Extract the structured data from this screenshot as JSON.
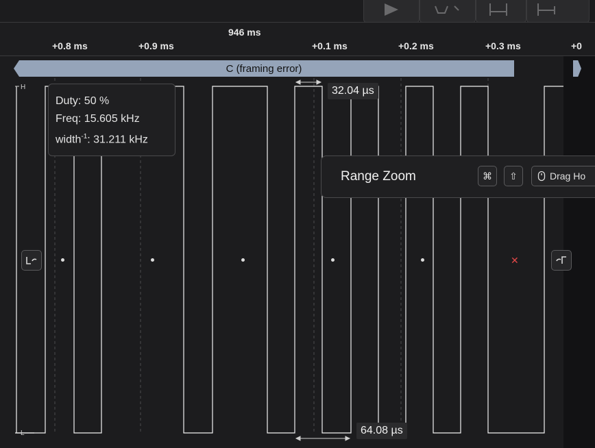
{
  "ruler": {
    "center_time": "946 ms",
    "ticks": [
      "+0.8 ms",
      "+0.9 ms",
      "+0.1 ms",
      "+0.2 ms",
      "+0.3 ms",
      "+0"
    ]
  },
  "frame": {
    "label": "C (framing error)"
  },
  "levels": {
    "high": "H",
    "low": "L"
  },
  "tooltip": {
    "duty": "Duty: 50 %",
    "freq": "Freq: 15.605 kHz",
    "width_prefix": "width",
    "width_sup": "-1",
    "width_value": ": 31.211 kHz"
  },
  "measurements": {
    "top": "32.04 µs",
    "bottom": "64.08 µs"
  },
  "range_zoom": {
    "title": "Range Zoom",
    "keys": [
      "⌘",
      "⇧"
    ],
    "drag_label": "Drag Ho"
  },
  "icons": {
    "prev_edge": "prev-edge-icon",
    "next_edge": "next-edge-icon",
    "play": "play-icon",
    "mouse": "mouse-icon"
  },
  "colors": {
    "background": "#1c1c1e",
    "frame_bar": "#95a4b9",
    "waveform": "#f2f2f2",
    "error": "#e24848"
  }
}
